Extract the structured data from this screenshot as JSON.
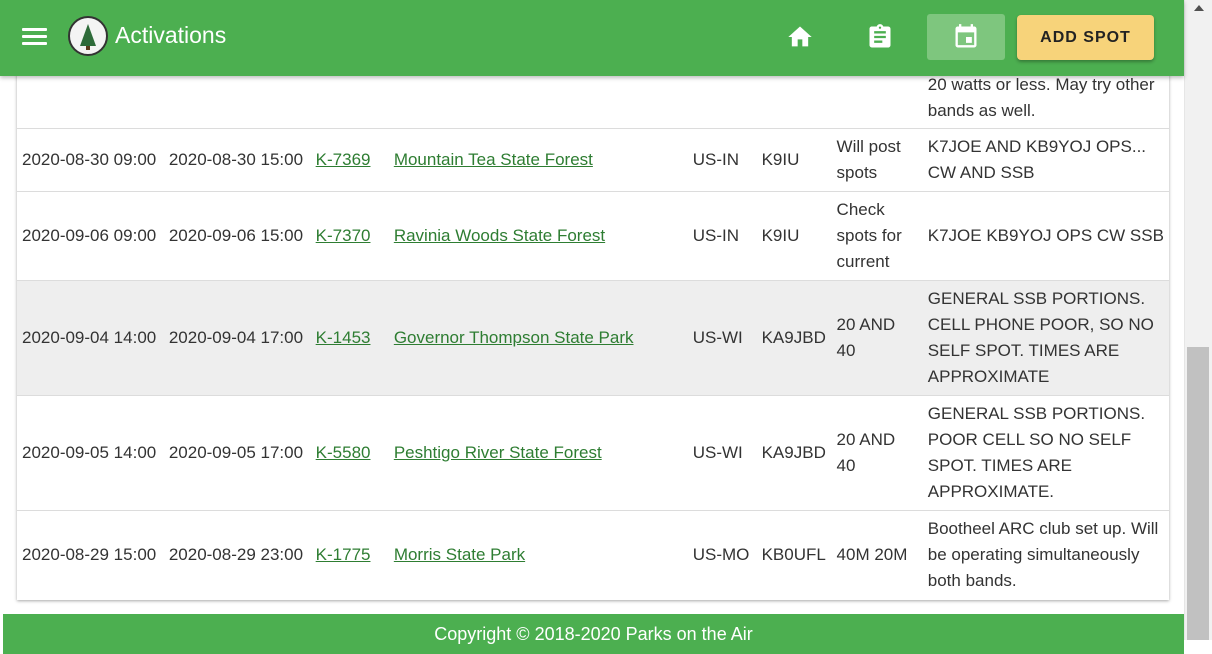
{
  "header": {
    "title": "Activations",
    "add_spot_label": "ADD SPOT",
    "icons": [
      "menu-icon",
      "logo",
      "home-icon",
      "clipboard-icon",
      "calendar-icon"
    ],
    "accent_color": "#4caf50",
    "button_color": "#f7d37a"
  },
  "table": {
    "partial_row_comment": "20 watts or less. May try other bands as well.",
    "rows": [
      {
        "start": "2020-08-30 09:00",
        "end": "2020-08-30 15:00",
        "ref": "K-7369",
        "park": "Mountain Tea State Forest",
        "location": "US-IN",
        "callsign": "K9IU",
        "frequencies": "Will post spots",
        "comments": "K7JOE AND KB9YOJ OPS... CW AND SSB"
      },
      {
        "start": "2020-09-06 09:00",
        "end": "2020-09-06 15:00",
        "ref": "K-7370",
        "park": "Ravinia Woods State Forest",
        "location": "US-IN",
        "callsign": "K9IU",
        "frequencies": "Check spots for current",
        "comments": "K7JOE KB9YOJ OPS CW SSB"
      },
      {
        "start": "2020-09-04 14:00",
        "end": "2020-09-04 17:00",
        "ref": "K-1453",
        "park": "Governor Thompson State Park",
        "location": "US-WI",
        "callsign": "KA9JBD",
        "frequencies": "20 AND 40",
        "comments": "GENERAL SSB PORTIONS. CELL PHONE POOR, SO NO SELF SPOT. TIMES ARE APPROXIMATE"
      },
      {
        "start": "2020-09-05 14:00",
        "end": "2020-09-05 17:00",
        "ref": "K-5580",
        "park": "Peshtigo River State Forest",
        "location": "US-WI",
        "callsign": "KA9JBD",
        "frequencies": "20 AND 40",
        "comments": "GENERAL SSB PORTIONS. POOR CELL SO NO SELF SPOT. TIMES ARE APPROXIMATE."
      },
      {
        "start": "2020-08-29 15:00",
        "end": "2020-08-29 23:00",
        "ref": "K-1775",
        "park": "Morris State Park",
        "location": "US-MO",
        "callsign": "KB0UFL",
        "frequencies": "40M 20M",
        "comments": "Bootheel ARC club set up. Will be operating simultaneously both bands."
      }
    ]
  },
  "footer": {
    "copyright": "Copyright © 2018-2020 Parks on the Air"
  }
}
